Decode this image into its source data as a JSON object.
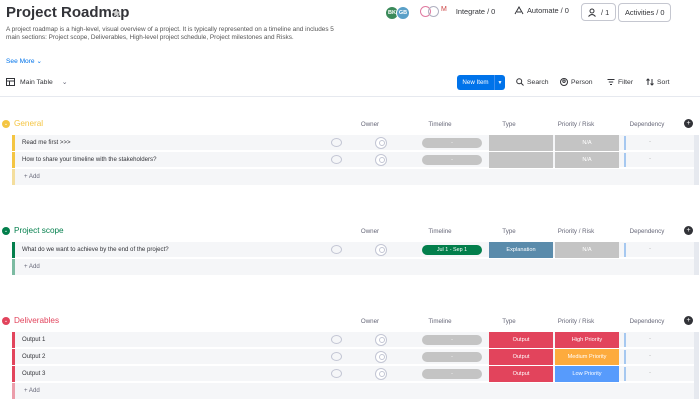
{
  "header": {
    "title": "Project Roadmap",
    "description": "A project roadmap is a high-level, visual overview of a project. It is typically represented on a timeline and includes 5 main sections: Project scope, Deliverables, High-level project schedule, Project milestones and Risks.",
    "see_more": "See More",
    "avatars": [
      "BK",
      "GB"
    ],
    "integrate": "Integrate / 0",
    "automate": "Automate / 0",
    "members": "/ 1",
    "activities": "Activities / 0"
  },
  "toolbar": {
    "view": "Main Table",
    "new_item": "New Item",
    "search": "Search",
    "person": "Person",
    "filter": "Filter",
    "sort": "Sort"
  },
  "columns": {
    "owner": "Owner",
    "timeline": "Timeline",
    "type": "Type",
    "priority": "Priority / Risk",
    "dependency": "Dependency"
  },
  "add_label": "+ Add",
  "colors": {
    "accent": "#0073ea",
    "general": "#fdab3d",
    "scope": "#037f4c",
    "deliverables": "#e2445c",
    "output": "#e2445c",
    "high": "#e2445c",
    "medium": "#fdab3d",
    "low": "#579bfc",
    "explanation": "#5a8bab",
    "timeline_done": "#037f4c",
    "empty": "#c4c4c4"
  },
  "groups": [
    {
      "name": "General",
      "color": "#f4c542",
      "rows": [
        {
          "name": "Read me first >>>",
          "timeline": "-",
          "type": "",
          "priority": "N/A",
          "dependency": "-"
        },
        {
          "name": "How to share your timeline with the stakeholders?",
          "timeline": "-",
          "type": "",
          "priority": "N/A",
          "dependency": "-"
        }
      ]
    },
    {
      "name": "Project scope",
      "color": "#037f4c",
      "rows": [
        {
          "name": "What do we want to achieve by the end of the project?",
          "timeline": "Jul 1 - Sep 1",
          "type": "Explanation",
          "priority": "N/A",
          "dependency": "-"
        }
      ]
    },
    {
      "name": "Deliverables",
      "color": "#e2445c",
      "rows": [
        {
          "name": "Output 1",
          "timeline": "-",
          "type": "Output",
          "priority": "High Priority",
          "dependency": "-"
        },
        {
          "name": "Output 2",
          "timeline": "-",
          "type": "Output",
          "priority": "Medium Priority",
          "dependency": "-"
        },
        {
          "name": "Output 3",
          "timeline": "-",
          "type": "Output",
          "priority": "Low Priority",
          "dependency": "-"
        }
      ]
    }
  ]
}
